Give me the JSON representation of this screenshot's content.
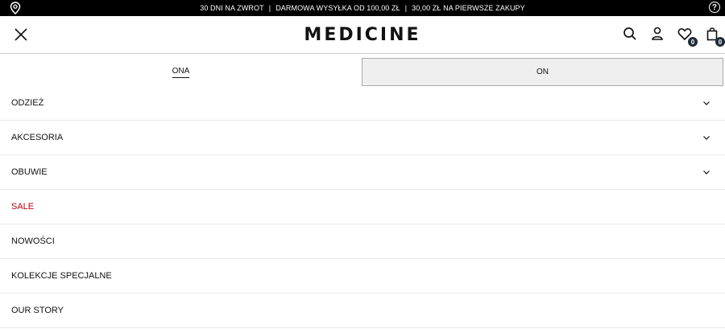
{
  "topbar": {
    "promo_1": "30 DNI NA ZWROT",
    "promo_2": "DARMOWA WYSYŁKA OD 100,00 ZŁ",
    "promo_3": "30,00 ZŁ NA PIERWSZE ZAKUPY",
    "separator": "|",
    "help_label": "?"
  },
  "header": {
    "logo": "MEDICINE",
    "wishlist_count": "0",
    "cart_count": "0"
  },
  "tabs": {
    "women": "ONA",
    "men": "ON"
  },
  "menu": {
    "items": [
      {
        "label": "ODZIEŻ",
        "expandable": true
      },
      {
        "label": "AKCESORIA",
        "expandable": true
      },
      {
        "label": "OBUWIE",
        "expandable": true
      },
      {
        "label": "SALE",
        "expandable": false,
        "color": "#c0000c"
      },
      {
        "label": "NOWOŚCI",
        "expandable": false
      },
      {
        "label": "KOLEKCJE SPECJALNE",
        "expandable": false
      },
      {
        "label": "OUR STORY",
        "expandable": false
      }
    ]
  },
  "icons": {
    "location": "location-pin-icon",
    "help": "help-icon",
    "close": "close-icon",
    "search": "search-icon",
    "account": "user-icon",
    "wishlist": "heart-icon",
    "cart": "bag-icon",
    "expand": "chevron-down-icon"
  }
}
